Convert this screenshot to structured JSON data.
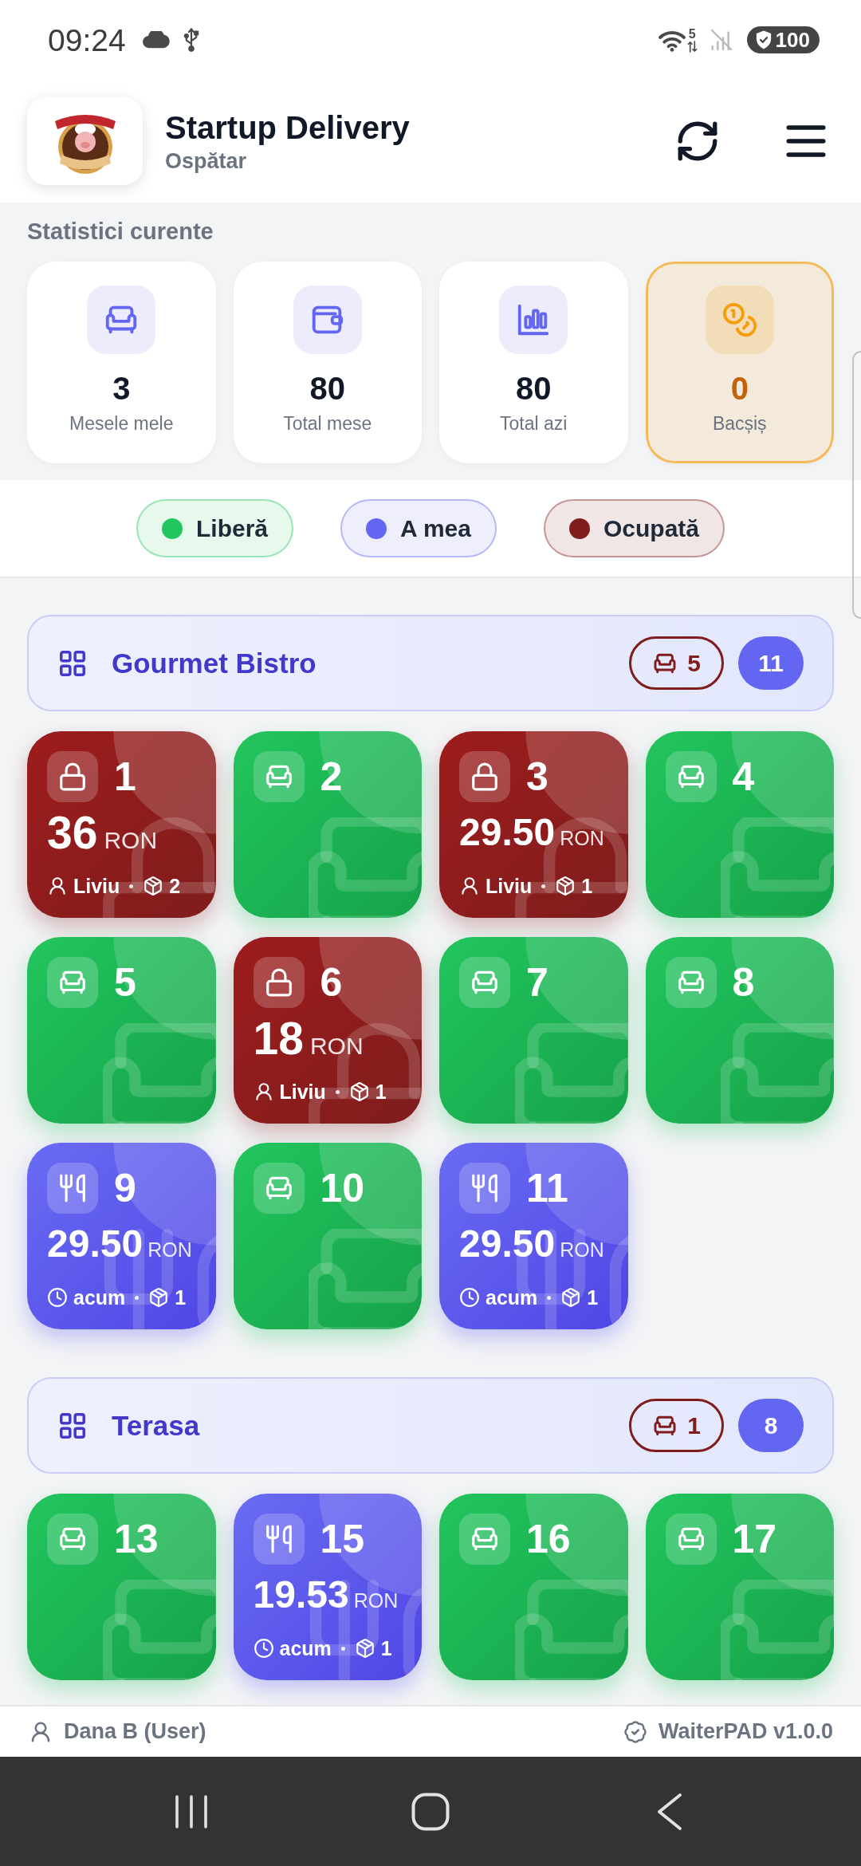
{
  "status_bar": {
    "time": "09:24",
    "wifi_label": "5",
    "battery": "100"
  },
  "header": {
    "title": "Startup Delivery",
    "subtitle": "Ospătar"
  },
  "stats": {
    "title": "Statistici curente",
    "cards": [
      {
        "value": "3",
        "label": "Mesele mele",
        "color": "#6366f1",
        "highlighted": false
      },
      {
        "value": "80",
        "label": "Total mese",
        "color": "#6366f1",
        "highlighted": false
      },
      {
        "value": "80",
        "label": "Total azi",
        "color": "#6366f1",
        "highlighted": false
      },
      {
        "value": "0",
        "label": "Bacșiș",
        "color": "#f59e0b",
        "highlighted": true
      }
    ]
  },
  "legend": [
    {
      "label": "Liberă",
      "color": "#22c55e"
    },
    {
      "label": "A mea",
      "color": "#6366f1"
    },
    {
      "label": "Ocupată",
      "color": "#7f1d1d"
    }
  ],
  "sections": [
    {
      "name": "Gourmet Bistro",
      "occupied_count": "5",
      "table_count": "11",
      "tables": [
        {
          "number": "1",
          "kind": "occupied",
          "amount": "36",
          "currency": "RON",
          "waiter": "Liviu",
          "items": "2"
        },
        {
          "number": "2",
          "kind": "free"
        },
        {
          "number": "3",
          "kind": "occupied",
          "amount": "29.50",
          "currency": "RON",
          "waiter": "Liviu",
          "items": "1"
        },
        {
          "number": "4",
          "kind": "free"
        },
        {
          "number": "5",
          "kind": "free"
        },
        {
          "number": "6",
          "kind": "occupied",
          "amount": "18",
          "currency": "RON",
          "waiter": "Liviu",
          "items": "1"
        },
        {
          "number": "7",
          "kind": "free"
        },
        {
          "number": "8",
          "kind": "free"
        },
        {
          "number": "9",
          "kind": "mine",
          "amount": "29.50",
          "currency": "RON",
          "since": "acum",
          "items": "1"
        },
        {
          "number": "10",
          "kind": "free"
        },
        {
          "number": "11",
          "kind": "mine",
          "amount": "29.50",
          "currency": "RON",
          "since": "acum",
          "items": "1"
        }
      ]
    },
    {
      "name": "Terasa",
      "occupied_count": "1",
      "table_count": "8",
      "tables": [
        {
          "number": "13",
          "kind": "free"
        },
        {
          "number": "15",
          "kind": "mine",
          "amount": "19.53",
          "currency": "RON",
          "since": "acum",
          "items": "1"
        },
        {
          "number": "16",
          "kind": "free"
        },
        {
          "number": "17",
          "kind": "free"
        }
      ]
    }
  ],
  "footer": {
    "user": "Dana B (User)",
    "version": "WaiterPAD v1.0.0"
  }
}
